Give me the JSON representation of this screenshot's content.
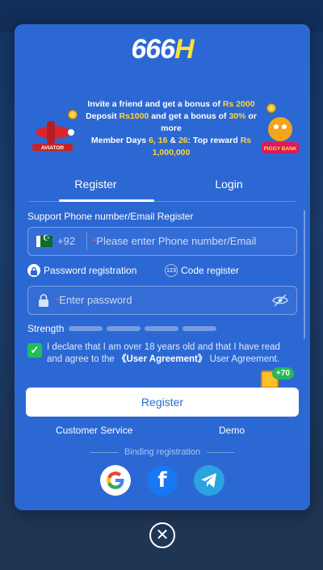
{
  "brand": {
    "logo_num": "666",
    "logo_letter": "H"
  },
  "banner": {
    "line1_a": "Invite a friend and get a bonus of ",
    "line1_b": "Rs 2000",
    "line2_a": "Deposit ",
    "line2_b": "Rs1000",
    "line2_c": " and get a bonus of ",
    "line2_d": "30%",
    "line2_e": " or more",
    "line3_a": "Member Days ",
    "line3_b": "6, 16",
    "line3_c": " & ",
    "line3_d": "26",
    "line3_e": ": Top reward ",
    "line3_f": "Rs 1,000,000",
    "left_game": "AVIATOR",
    "right_game": "PIGGY BANK"
  },
  "tabs": {
    "register": "Register",
    "login": "Login"
  },
  "form": {
    "section_title": "Support Phone number/Email Register",
    "country_code": "+92",
    "phone_placeholder": "Please enter Phone number/Email",
    "required_mark": "*",
    "password_registration": "Password registration",
    "code_register": "Code register",
    "code_icon_text": "123",
    "password_placeholder": "Enter password",
    "strength_label": "Strength",
    "agree_text_1": "I declare that I am over 18 years old and that I have read and agree to the ",
    "agree_link": "《User Agreement》",
    "agree_text_2": " User Agreement.",
    "gift_badge": "+70",
    "register_button": "Register"
  },
  "links": {
    "customer_service": "Customer Service",
    "demo": "Demo"
  },
  "binding_label": "Binding registration",
  "social_icons": [
    "google-icon",
    "facebook-icon",
    "telegram-icon"
  ],
  "close_icon": "close-icon",
  "colors": {
    "modal_bg": "#2c68d4",
    "accent_yellow": "#ffd43b",
    "check_green": "#1fbf5a"
  }
}
